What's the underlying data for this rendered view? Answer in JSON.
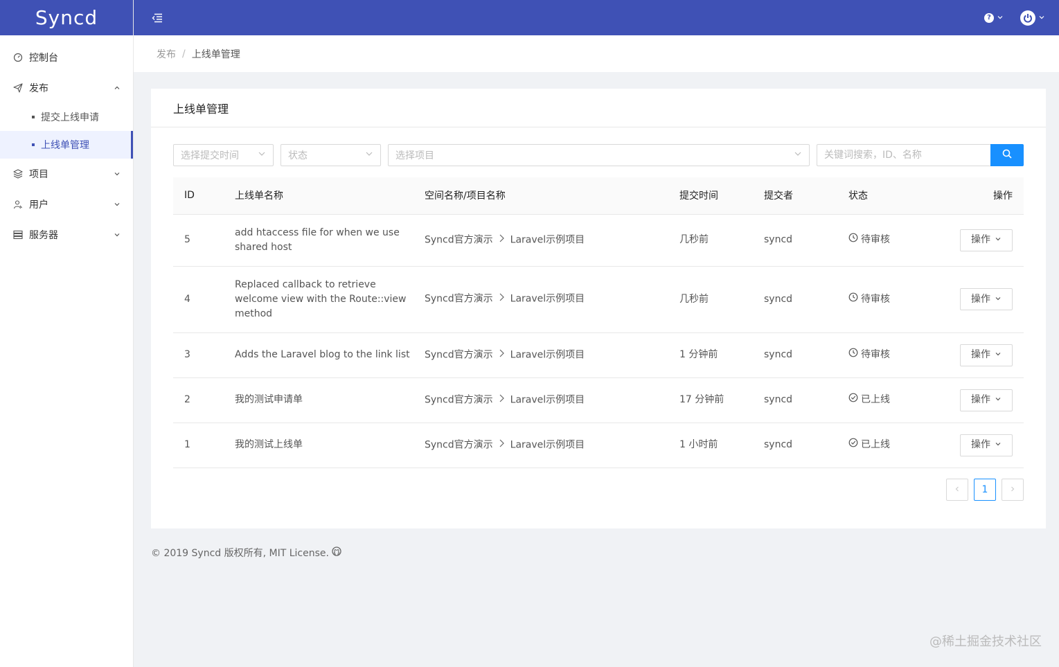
{
  "app": {
    "logo": "Syncd"
  },
  "sidebar": {
    "items": [
      {
        "label": "控制台"
      },
      {
        "label": "发布",
        "children": [
          {
            "label": "提交上线申请"
          },
          {
            "label": "上线单管理"
          }
        ]
      },
      {
        "label": "项目"
      },
      {
        "label": "用户"
      },
      {
        "label": "服务器"
      }
    ]
  },
  "breadcrumb": {
    "parent": "发布",
    "separator": "/",
    "current": "上线单管理"
  },
  "card": {
    "title": "上线单管理"
  },
  "filters": {
    "time_placeholder": "选择提交时间",
    "status_placeholder": "状态",
    "project_placeholder": "选择项目",
    "search_placeholder": "关键词搜索，ID、名称"
  },
  "table": {
    "columns": [
      "ID",
      "上线单名称",
      "空间名称/项目名称",
      "提交时间",
      "提交者",
      "状态",
      "操作"
    ],
    "rows": [
      {
        "id": "5",
        "name_lines": [
          "add htaccess file for when we use",
          "shared host"
        ],
        "space": "Syncd官方演示",
        "project": "Laravel示例项目",
        "time": "几秒前",
        "user": "syncd",
        "status": "待审核",
        "action": "操作"
      },
      {
        "id": "4",
        "name_lines": [
          "Replaced callback to retrieve",
          "welcome view with the Route::view",
          "method"
        ],
        "space": "Syncd官方演示",
        "project": "Laravel示例项目",
        "time": "几秒前",
        "user": "syncd",
        "status": "待审核",
        "action": "操作"
      },
      {
        "id": "3",
        "name_lines": [
          "Adds the Laravel blog to the link list"
        ],
        "space": "Syncd官方演示",
        "project": "Laravel示例项目",
        "time": "1 分钟前",
        "user": "syncd",
        "status": "待审核",
        "action": "操作"
      },
      {
        "id": "2",
        "name_lines": [
          "我的测试申请单"
        ],
        "space": "Syncd官方演示",
        "project": "Laravel示例项目",
        "time": "17 分钟前",
        "user": "syncd",
        "status": "已上线",
        "action": "操作"
      },
      {
        "id": "1",
        "name_lines": [
          "我的测试上线单"
        ],
        "space": "Syncd官方演示",
        "project": "Laravel示例项目",
        "time": "1 小时前",
        "user": "syncd",
        "status": "已上线",
        "action": "操作"
      }
    ]
  },
  "pagination": {
    "current": "1",
    "prev": "<",
    "next": ">"
  },
  "footer": {
    "text": "© 2019 Syncd 版权所有, MIT License."
  },
  "watermark": "@稀土掘金技术社区",
  "colors": {
    "primary": "#3f51b5",
    "accent": "#1890ff"
  }
}
